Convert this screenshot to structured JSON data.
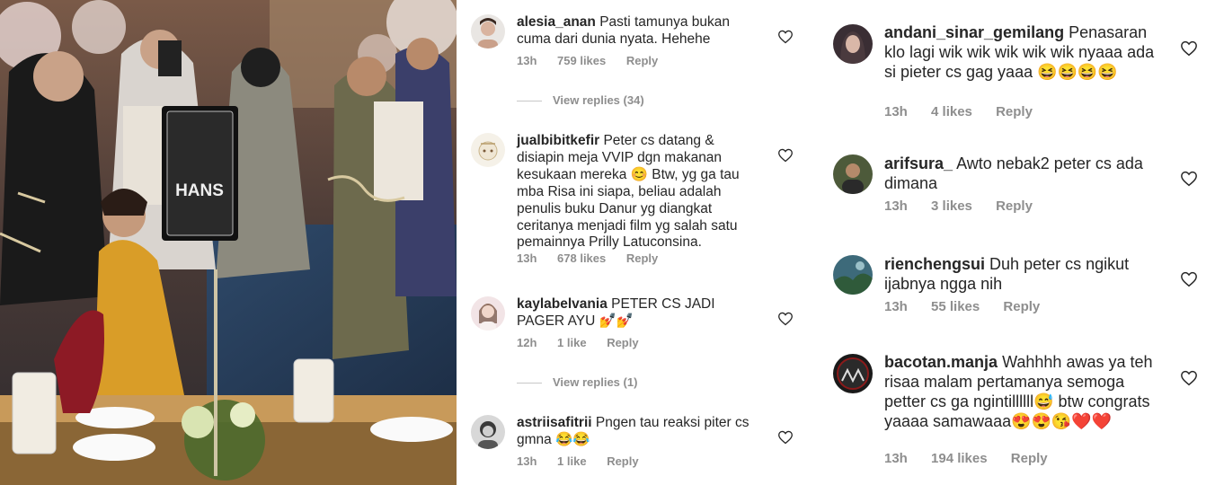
{
  "photo": {
    "sign_text": "HANS"
  },
  "icons": {
    "like": "heart-outline-icon"
  },
  "colors": {
    "meta": "#8e8e8e",
    "text": "#262626"
  },
  "left_comments": [
    {
      "username": "alesia_anan",
      "text": "Pasti tamunya bukan cuma dari dunia nyata. Hehehe",
      "time": "13h",
      "likes": "759 likes",
      "reply": "Reply",
      "view_replies": "View replies (34)"
    },
    {
      "username": "jualbibitkefir",
      "text": "Peter cs datang & disiapin meja VVIP dgn makanan kesukaan mereka 😊 Btw, yg ga tau mba Risa ini siapa, beliau adalah penulis buku Danur yg diangkat ceritanya menjadi film yg salah satu pemainnya Prilly Latuconsina.",
      "time": "13h",
      "likes": "678 likes",
      "reply": "Reply"
    },
    {
      "username": "kaylabelvania",
      "text": "PETER CS JADI PAGER AYU 💅💅",
      "time": "12h",
      "likes": "1 like",
      "reply": "Reply",
      "view_replies": "View replies (1)"
    },
    {
      "username": "astriisafitrii",
      "text": "Pngen tau reaksi piter cs gmna 😂😂",
      "time": "13h",
      "likes": "1 like",
      "reply": "Reply"
    }
  ],
  "right_comments": [
    {
      "username": "andani_sinar_gemilang",
      "text": "Penasaran klo lagi wik wik wik wik wik nyaaa ada si pieter cs gag yaaa 😆😆😆😆",
      "time": "13h",
      "likes": "4 likes",
      "reply": "Reply"
    },
    {
      "username": "arifsura_",
      "text": "Awto nebak2 peter cs ada dimana",
      "time": "13h",
      "likes": "3 likes",
      "reply": "Reply"
    },
    {
      "username": "rienchengsui",
      "text": "Duh peter cs ngikut ijabnya ngga nih",
      "time": "13h",
      "likes": "55 likes",
      "reply": "Reply"
    },
    {
      "username": "bacotan.manja",
      "text": "Wahhhh awas ya teh risaa malam pertamanya semoga petter cs ga ngintillllll😅 btw congrats yaaaa samawaaa😍😍😘❤️❤️",
      "time": "13h",
      "likes": "194 likes",
      "reply": "Reply"
    }
  ]
}
